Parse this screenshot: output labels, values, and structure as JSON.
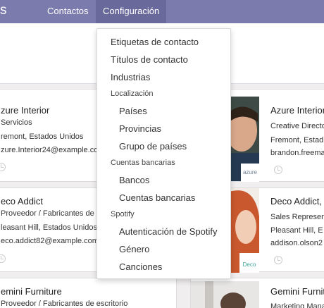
{
  "navbar": {
    "brand": "s",
    "menu_contactos": "Contactos",
    "menu_configuracion": "Configuración"
  },
  "dropdown": {
    "items": [
      {
        "label": "Etiquetas de contacto"
      },
      {
        "label": "Títulos de contacto"
      },
      {
        "label": "Industrias"
      }
    ],
    "section_localizacion": "Localización",
    "localizacion_items": [
      {
        "label": "Países"
      },
      {
        "label": "Provincias"
      },
      {
        "label": "Grupo de países"
      }
    ],
    "section_bancos": "Cuentas bancarias",
    "bancos_items": [
      {
        "label": "Bancos"
      },
      {
        "label": "Cuentas bancarias"
      }
    ],
    "section_spotify": "Spotify",
    "spotify_items": [
      {
        "label": "Autenticación de Spotify"
      },
      {
        "label": "Género"
      },
      {
        "label": "Canciones"
      }
    ]
  },
  "cards_left": [
    {
      "name": "zure Interior",
      "line1": "Servicios",
      "line2": "remont, Estados Unidos",
      "line3": "zure.Interior24@example.co"
    },
    {
      "name": "eco Addict",
      "line1": "Proveedor / Fabricantes de",
      "line2": "leasant Hill, Estados Unidos",
      "line3": "eco.addict82@example.com"
    },
    {
      "name": "emini Furniture",
      "line1": "Proveedor / Fabricantes de escritorio"
    }
  ],
  "cards_right": [
    {
      "name": "Azure Interior",
      "line1": "Creative Directo",
      "line2": "Fremont, Estad",
      "line3": "brandon.freema",
      "logo": "azure"
    },
    {
      "name": "Deco Addict, ",
      "line1": "Sales Represen",
      "line2": "Pleasant Hill, E",
      "line3": "addison.olson2",
      "logo": "Deco"
    },
    {
      "name": "Gemini Furnit",
      "line1": "Marketing Mana"
    }
  ],
  "colors": {
    "navbar": "#7c7bad",
    "navbar_active": "#6a699b"
  }
}
